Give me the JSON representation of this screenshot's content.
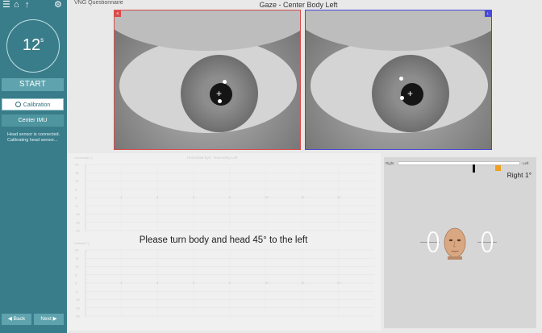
{
  "header": {
    "left_text": "VNG Questionnaire",
    "title": "Gaze - Center Body Left"
  },
  "sidebar": {
    "icons": [
      "menu-icon",
      "home-icon",
      "upload-icon",
      "gear-icon"
    ],
    "timer_value": "12",
    "timer_unit": "s",
    "start_label": "START",
    "calibration_label": "Calibration",
    "center_imu_label": "Center IMU",
    "status_line1": "Head sensor is connected.",
    "status_line2": "Calibrating head sensor...",
    "back_label": "Back",
    "next_label": "Next"
  },
  "eyes": {
    "right_corner": "R",
    "left_corner": "L",
    "right_border_color": "#d94c4c",
    "left_border_color": "#4a4ad9"
  },
  "plots": {
    "plot1_title": "Horizontal Eye · Recording Left",
    "plot1_label": "Horizontal (°)",
    "plot2_label": "Vertical (°)",
    "y_ticks": [
      "20",
      "15",
      "10",
      "5",
      "0",
      "-5",
      "-10",
      "-15",
      "-20"
    ],
    "x_ticks": [
      "2",
      "4",
      "6",
      "8",
      "10",
      "12",
      "14"
    ],
    "instruction": "Please turn body and head 45° to the left"
  },
  "head_position": {
    "right_label": "Right",
    "left_label": "Left",
    "readout": "Right 1°",
    "marker_color": "#f0a020"
  }
}
